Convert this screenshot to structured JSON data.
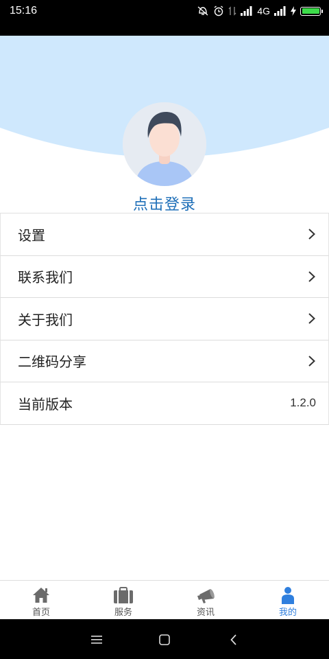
{
  "status_bar": {
    "time": "15:16",
    "network": "4G",
    "battery_level": 1.0,
    "icons": [
      "dnd-icon",
      "alarm-icon",
      "data-icon",
      "signal-icon",
      "signal-icon",
      "charging-icon",
      "battery-icon"
    ]
  },
  "header": {
    "login_text": "点击登录",
    "bg_color": "#cfe8fd",
    "avatar_icon": "user-avatar-icon"
  },
  "menu": {
    "items": [
      {
        "label": "设置",
        "icon": "chevron-right-icon"
      },
      {
        "label": "联系我们",
        "icon": "chevron-right-icon"
      },
      {
        "label": "关于我们",
        "icon": "chevron-right-icon"
      },
      {
        "label": "二维码分享",
        "icon": "chevron-right-icon"
      },
      {
        "label": "当前版本",
        "value": "1.2.0"
      }
    ]
  },
  "tabs": [
    {
      "label": "首页",
      "icon": "home-icon",
      "active": false
    },
    {
      "label": "服务",
      "icon": "briefcase-icon",
      "active": false
    },
    {
      "label": "资讯",
      "icon": "megaphone-icon",
      "active": false
    },
    {
      "label": "我的",
      "icon": "person-icon",
      "active": true
    }
  ],
  "colors": {
    "accent": "#2f7fde",
    "login_link": "#1e6fb8",
    "inactive_tab_icon": "#6b6b6b"
  },
  "nav_bar": {
    "buttons": [
      "menu-icon",
      "home-square-icon",
      "back-icon"
    ]
  }
}
